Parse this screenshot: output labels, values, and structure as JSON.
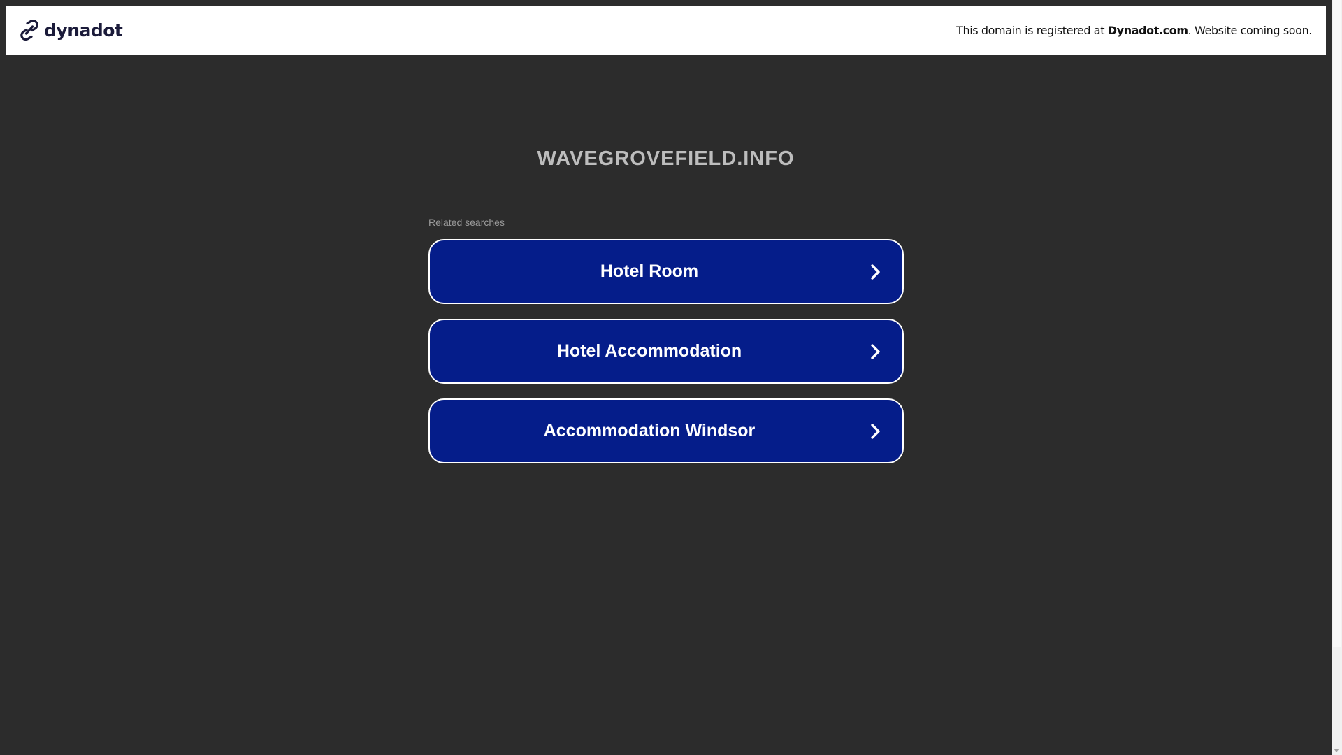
{
  "banner": {
    "logo_text": "dynadot",
    "logo_icon": "link-icon",
    "message_prefix": "This domain is registered at ",
    "message_brand": "Dynadot.com",
    "message_suffix": ". Website coming soon."
  },
  "main": {
    "domain": "WAVEGROVEFIELD.INFO",
    "related_label": "Related searches",
    "results": [
      {
        "label": "Hotel Room",
        "icon": "chevron-right-icon"
      },
      {
        "label": "Hotel Accommodation",
        "icon": "chevron-right-icon"
      },
      {
        "label": "Accommodation Windsor",
        "icon": "chevron-right-icon"
      }
    ]
  },
  "colors": {
    "background": "#2c2c2c",
    "button": "#051d8a",
    "banner": "#ffffff"
  }
}
